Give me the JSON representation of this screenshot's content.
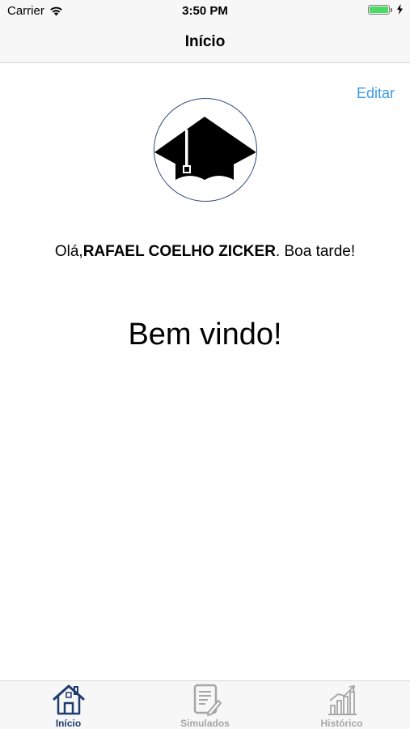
{
  "status_bar": {
    "carrier": "Carrier",
    "time": "3:50 PM",
    "battery_level": 1.0
  },
  "nav": {
    "title": "Início"
  },
  "edit_label": "Editar",
  "greeting": {
    "prefix": "Olá,",
    "name": "RAFAEL COELHO ZICKER",
    "suffix": ". Boa tarde!"
  },
  "welcome": "Bem vindo!",
  "tabs": [
    {
      "label": "Início",
      "icon": "house-icon",
      "active": true
    },
    {
      "label": "Simulados",
      "icon": "document-edit-icon",
      "active": false
    },
    {
      "label": "Histórico",
      "icon": "bar-chart-icon",
      "active": false
    }
  ],
  "colors": {
    "accent": "#3b9be8",
    "tab_active": "#1f3c6e",
    "tab_inactive": "#a6a6a6",
    "battery": "#4cd964"
  }
}
